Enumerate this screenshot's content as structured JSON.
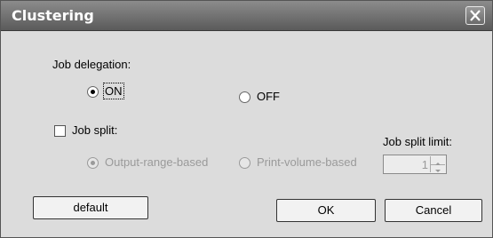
{
  "window": {
    "title": "Clustering",
    "close_icon": "close-icon"
  },
  "job_delegation": {
    "label": "Job delegation:",
    "on_label": "ON",
    "off_label": "OFF",
    "selected": "ON"
  },
  "job_split": {
    "label": "Job split:",
    "checked": false,
    "output_range_label": "Output-range-based",
    "print_volume_label": "Print-volume-based",
    "selected_mode": "Output-range-based",
    "limit_label": "Job split limit:",
    "limit_value": "1",
    "enabled": false
  },
  "buttons": {
    "default_label": "default",
    "ok_label": "OK",
    "cancel_label": "Cancel"
  }
}
